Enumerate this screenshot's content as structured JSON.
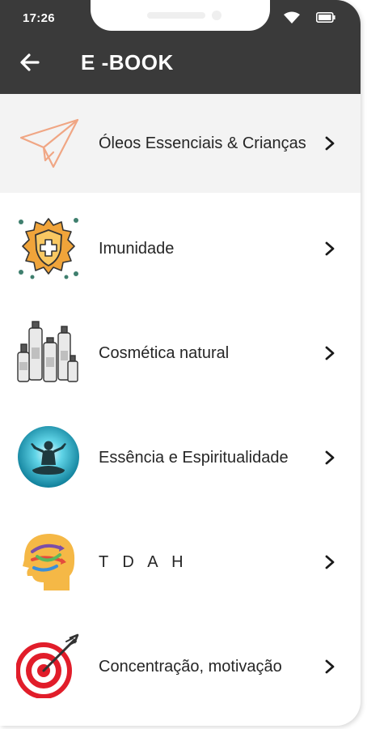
{
  "status_bar": {
    "time": "17:26",
    "wifi_icon": "wifi-icon",
    "battery_icon": "battery-icon"
  },
  "header": {
    "back_icon": "arrow-left-icon",
    "title": "E -BOOK",
    "background": "#3a3a3a"
  },
  "menu": {
    "chevron_icon": "chevron-right-icon",
    "items": [
      {
        "label": "Óleos Essenciais & Crianças",
        "icon": "paper-plane-icon",
        "selected": true
      },
      {
        "label": "Imunidade",
        "icon": "shield-plus-icon"
      },
      {
        "label": "Cosmética natural",
        "icon": "cosmetic-bottles-icon"
      },
      {
        "label": "Essência e Espiritualidade",
        "icon": "meditation-icon"
      },
      {
        "label": "T D A H",
        "icon": "head-brain-icon"
      },
      {
        "label": "Concentração, motivação",
        "icon": "target-arrow-icon"
      }
    ]
  }
}
